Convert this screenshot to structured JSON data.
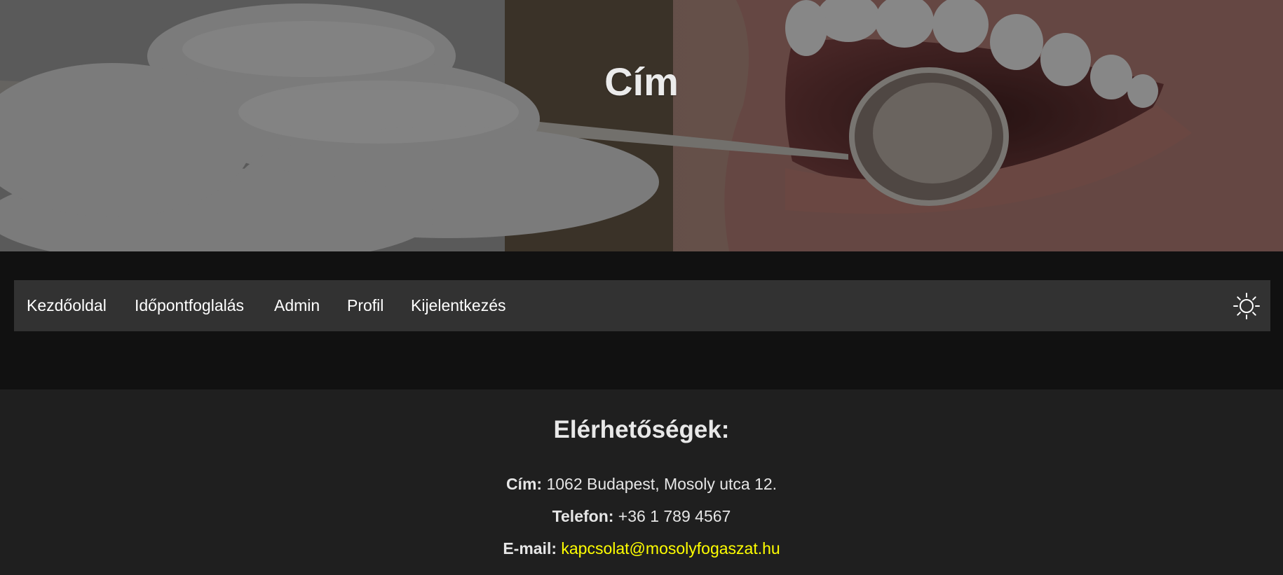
{
  "hero": {
    "title": "Cím",
    "image": "dentist-mirror-teeth-photo"
  },
  "nav": {
    "items": [
      {
        "label": "Kezdőoldal"
      },
      {
        "label": "Időpontfoglalás"
      },
      {
        "label": "Admin"
      },
      {
        "label": "Profil"
      },
      {
        "label": "Kijelentkezés"
      }
    ],
    "theme_toggle_icon": "sun-icon"
  },
  "footer": {
    "heading": "Elérhetőségek:",
    "address_label": "Cím:",
    "address_value": "1062 Budapest, Mosoly utca 12.",
    "phone_label": "Telefon:",
    "phone_value": "+36 1 789 4567",
    "email_label": "E-mail:",
    "email_value": "kapcsolat@mosolyfogaszat.hu",
    "email_color": "#ffff00"
  },
  "colors": {
    "page_bg": "#111111",
    "nav_bg": "#323232",
    "footer_bg": "#1f1f1f"
  }
}
